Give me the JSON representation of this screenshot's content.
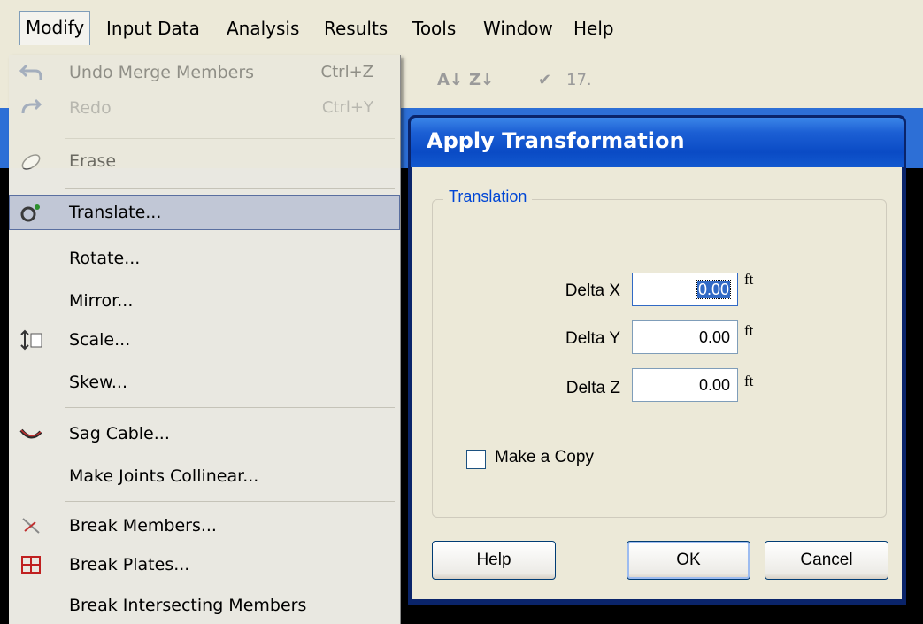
{
  "menubar": {
    "items": [
      "Modify",
      "Input Data",
      "Analysis",
      "Results",
      "Tools",
      "Window",
      "Help"
    ],
    "active": "Modify"
  },
  "toolbar": {
    "zoom_text": "17."
  },
  "modify_menu": {
    "items": [
      {
        "label": "Undo Merge Members",
        "shortcut": "Ctrl+Z",
        "icon": "undo-icon"
      },
      {
        "label": "Redo",
        "shortcut": "Ctrl+Y",
        "icon": "redo-icon"
      },
      {
        "label": "Erase",
        "icon": "eraser-icon"
      },
      {
        "label": "Translate...",
        "icon": "translate-icon",
        "selected": true
      },
      {
        "label": "Rotate..."
      },
      {
        "label": "Mirror..."
      },
      {
        "label": "Scale...",
        "icon": "scale-icon"
      },
      {
        "label": "Skew..."
      },
      {
        "label": "Sag Cable...",
        "icon": "cable-icon"
      },
      {
        "label": "Make Joints Collinear..."
      },
      {
        "label": "Break Members...",
        "icon": "break-members-icon"
      },
      {
        "label": "Break Plates...",
        "icon": "break-plates-icon"
      },
      {
        "label": "Break Intersecting Members"
      }
    ]
  },
  "dialog": {
    "title": "Apply Transformation",
    "group_label": "Translation",
    "fields": [
      {
        "label": "Delta X",
        "value": "0.00",
        "unit": "ft",
        "focused": true
      },
      {
        "label": "Delta Y",
        "value": "0.00",
        "unit": "ft"
      },
      {
        "label": "Delta Z",
        "value": "0.00",
        "unit": "ft"
      }
    ],
    "checkbox_label": "Make a Copy",
    "checkbox_checked": false,
    "buttons": {
      "help": "Help",
      "ok": "OK",
      "cancel": "Cancel"
    }
  },
  "colors": {
    "titlebar": "#0a4bc5",
    "menu_bg": "#e9e8e1",
    "selection": "#c1c7d6",
    "group_label": "#0046d5"
  }
}
